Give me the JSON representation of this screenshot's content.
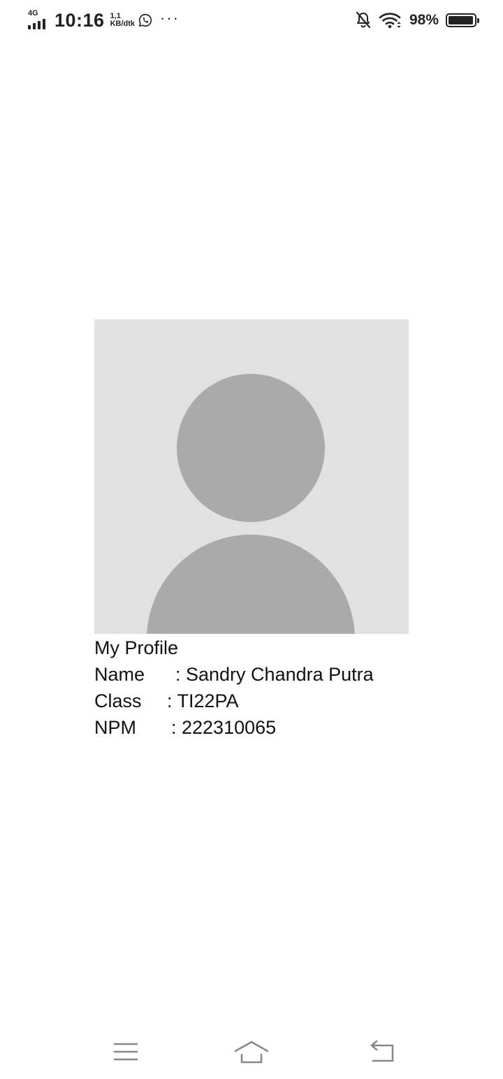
{
  "status_bar": {
    "network": "4G",
    "time": "10:16",
    "speed_value": "1,1",
    "speed_unit": "KB/dtk",
    "more": "···",
    "battery_percent": "98%",
    "battery_level": 0.98,
    "icons": [
      "signal-icon",
      "whatsapp-icon",
      "more-icon",
      "bell-muted-icon",
      "wifi-icon",
      "battery-icon"
    ]
  },
  "profile": {
    "title": "My Profile",
    "name_label": "Name",
    "name_value": ": Sandry Chandra Putra",
    "class_label": "Class",
    "class_value": ": TI22PA",
    "npm_label": "NPM",
    "npm_value": ": 222310065"
  },
  "colors": {
    "avatar_background": "#e1e1e1",
    "avatar_silhouette": "#aaaaaa",
    "nav_icon": "#888888"
  },
  "nav_bar": {
    "icons": [
      "menu-icon",
      "home-icon",
      "back-icon"
    ]
  }
}
